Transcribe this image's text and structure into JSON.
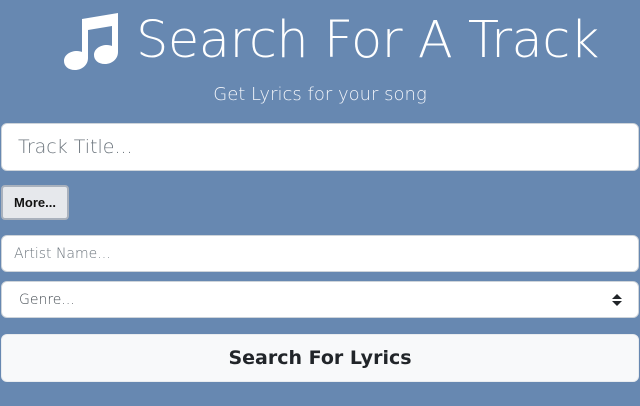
{
  "header": {
    "icon": "music-note-icon",
    "title": "Search For A Track",
    "subtitle": "Get Lyrics for your song"
  },
  "form": {
    "track_title": {
      "placeholder": "Track Title...",
      "value": ""
    },
    "more_button": {
      "label": "More..."
    },
    "artist_name": {
      "placeholder": "Artist Name...",
      "value": ""
    },
    "genre": {
      "selected": "Genre...",
      "icon": "select-arrows-icon"
    },
    "search_button": {
      "label": "Search For Lyrics"
    }
  },
  "colors": {
    "background": "#6788b1",
    "input_background": "#ffffff",
    "button_background": "#f8f9fa",
    "more_button_background": "#e6e8ec",
    "placeholder_text": "#6c757d"
  }
}
